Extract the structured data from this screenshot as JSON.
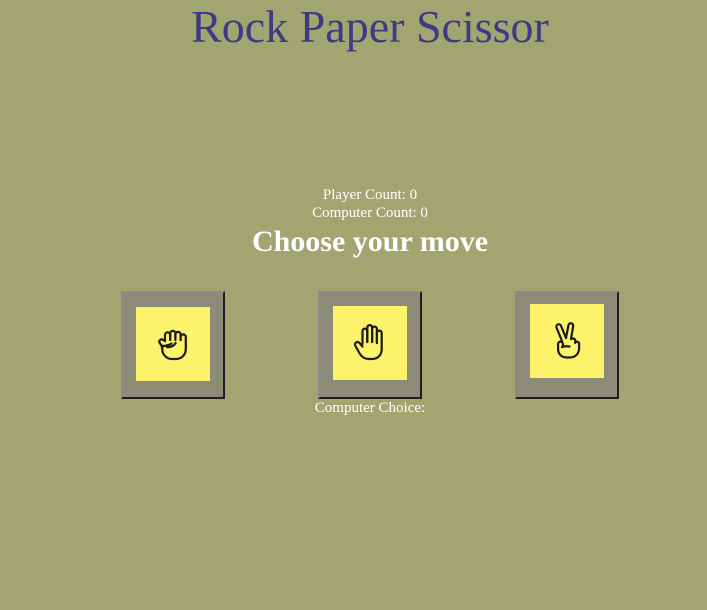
{
  "page": {
    "title": "Rock Paper Scissor",
    "background": "#a1a56f",
    "title_color": "#3f3a86"
  },
  "scoreboard": {
    "player_label": "Player Count:",
    "player_count": "0",
    "computer_label": "Computer Count:",
    "computer_count": "0"
  },
  "prompt": "Choose your move",
  "moves": [
    {
      "id": "rock",
      "icon": "fist-icon",
      "tile_color": "#fdf36a"
    },
    {
      "id": "paper",
      "icon": "open-hand-icon",
      "tile_color": "#fdf36a"
    },
    {
      "id": "scissors",
      "icon": "victory-hand-icon",
      "tile_color": "#fdf36a"
    }
  ],
  "result": {
    "computer_choice_label": "Computer Choice:",
    "computer_choice_value": ""
  }
}
